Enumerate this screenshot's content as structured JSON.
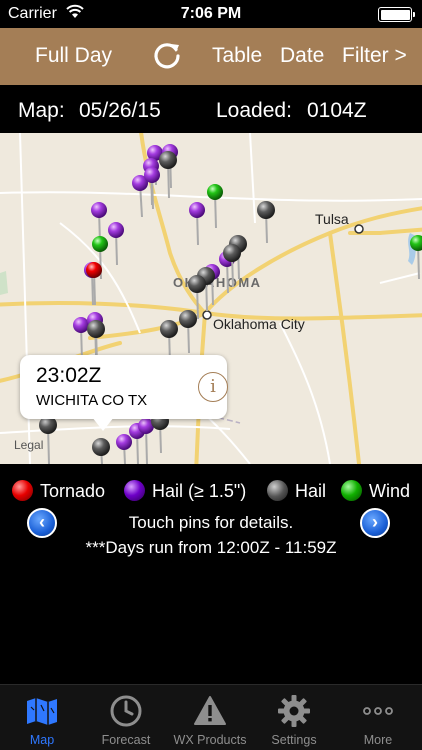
{
  "status_bar": {
    "carrier": "Carrier",
    "time": "7:06 PM"
  },
  "nav_bar": {
    "full_day_label": "Full Day",
    "refresh_icon": "refresh-icon",
    "table_label": "Table",
    "date_label": "Date",
    "filter_label": "Filter >"
  },
  "info_bar": {
    "map_label": "Map:",
    "map_date": "05/26/15",
    "loaded_label": "Loaded:",
    "loaded_time": "0104Z"
  },
  "map": {
    "city_labels": {
      "tulsa": "Tulsa",
      "oklahoma_state": "OKLAHOMA",
      "oklahoma_city": "Oklahoma City",
      "legal": "Legal"
    },
    "callout": {
      "time": "23:02Z",
      "location": "WICHITA CO TX",
      "info_symbol": "i"
    }
  },
  "legend": {
    "tornado": "Tornado",
    "hail_large": "Hail (≥ 1.5\")",
    "hail": "Hail",
    "wind": "Wind",
    "touch_hint": "Touch pins for details.",
    "days_note": "***Days run from 12:00Z - 11:59Z",
    "prev_symbol": "‹",
    "next_symbol": "›"
  },
  "colors": {
    "nav_bar": "#a47e56",
    "tornado": "#e80000",
    "hail_large": "#9b30d8",
    "hail": "#444444",
    "wind": "#18c010",
    "active_tab": "#2f78ff"
  },
  "tab_bar": {
    "tabs": [
      {
        "label": "Map",
        "icon": "map-icon",
        "active": true
      },
      {
        "label": "Forecast",
        "icon": "clock-icon",
        "active": false
      },
      {
        "label": "WX Products",
        "icon": "warning-icon",
        "active": false
      },
      {
        "label": "Settings",
        "icon": "gear-icon",
        "active": false
      },
      {
        "label": "More",
        "icon": "more-dots-icon",
        "active": false
      }
    ]
  }
}
